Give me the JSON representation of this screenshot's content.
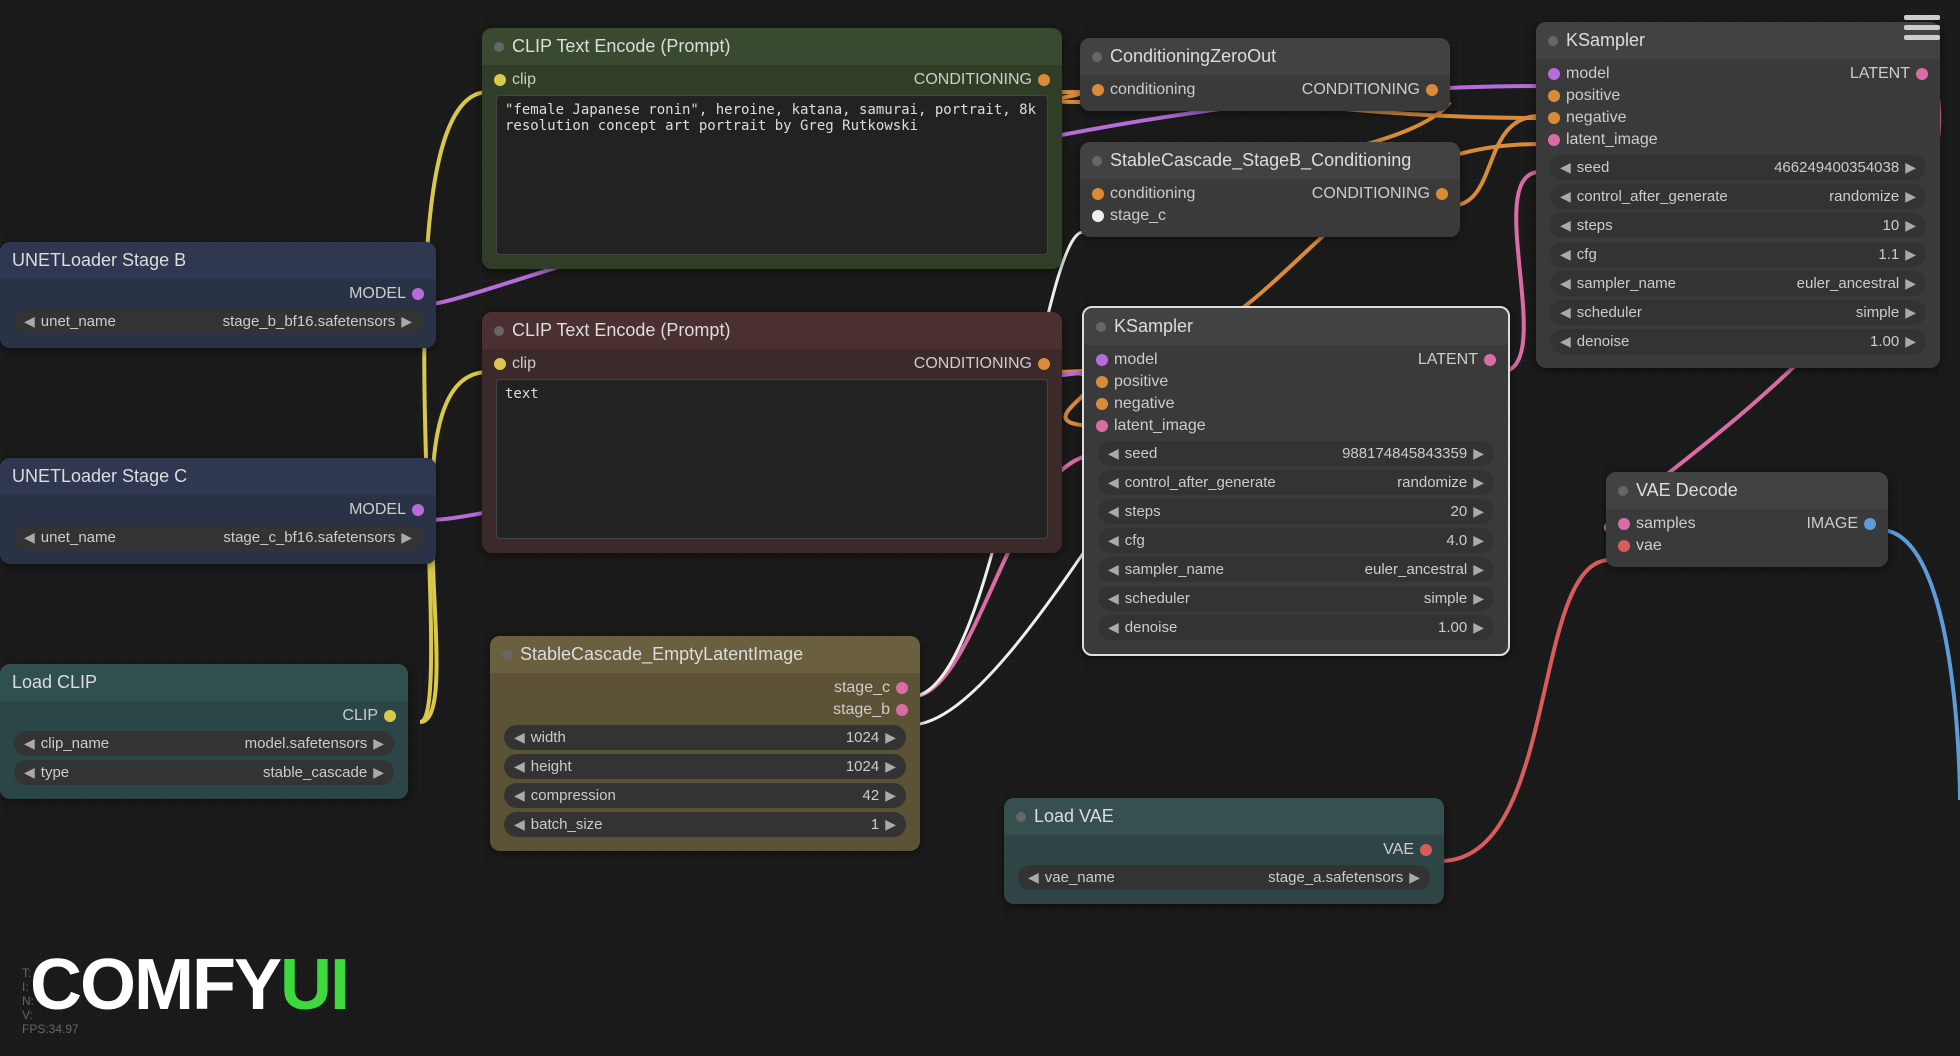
{
  "logo": {
    "part1": "COMFY",
    "part2": "UI"
  },
  "stats": {
    "t": "T: ",
    "i": "I: ",
    "n": "N: ",
    "v": "V: ",
    "fps": "FPS:34.97"
  },
  "nodes": {
    "unet_b": {
      "title": "UNETLoader Stage B",
      "out": "MODEL",
      "widget": {
        "label": "unet_name",
        "value": "stage_b_bf16.safetensors"
      }
    },
    "unet_c": {
      "title": "UNETLoader Stage C",
      "out": "MODEL",
      "widget": {
        "label": "unet_name",
        "value": "stage_c_bf16.safetensors"
      }
    },
    "load_clip": {
      "title": "Load CLIP",
      "out": "CLIP",
      "widgets": [
        {
          "label": "clip_name",
          "value": "model.safetensors"
        },
        {
          "label": "type",
          "value": "stable_cascade"
        }
      ]
    },
    "clip_pos": {
      "title": "CLIP Text Encode (Prompt)",
      "in": "clip",
      "out": "CONDITIONING",
      "text": "\"female Japanese ronin\", heroine, katana, samurai, portrait, 8k\nresolution concept art portrait by Greg Rutkowski"
    },
    "clip_neg": {
      "title": "CLIP Text Encode (Prompt)",
      "in": "clip",
      "out": "CONDITIONING",
      "text": "text"
    },
    "empty_latent": {
      "title": "StableCascade_EmptyLatentImage",
      "out1": "stage_c",
      "out2": "stage_b",
      "widgets": [
        {
          "label": "width",
          "value": "1024"
        },
        {
          "label": "height",
          "value": "1024"
        },
        {
          "label": "compression",
          "value": "42"
        },
        {
          "label": "batch_size",
          "value": "1"
        }
      ]
    },
    "cond_zero": {
      "title": "ConditioningZeroOut",
      "in": "conditioning",
      "out": "CONDITIONING"
    },
    "stageb_cond": {
      "title": "StableCascade_StageB_Conditioning",
      "in1": "conditioning",
      "in2": "stage_c",
      "out": "CONDITIONING"
    },
    "ksampler1": {
      "title": "KSampler",
      "ins": [
        "model",
        "positive",
        "negative",
        "latent_image"
      ],
      "out": "LATENT",
      "widgets": [
        {
          "label": "seed",
          "value": "988174845843359"
        },
        {
          "label": "control_after_generate",
          "value": "randomize"
        },
        {
          "label": "steps",
          "value": "20"
        },
        {
          "label": "cfg",
          "value": "4.0"
        },
        {
          "label": "sampler_name",
          "value": "euler_ancestral"
        },
        {
          "label": "scheduler",
          "value": "simple"
        },
        {
          "label": "denoise",
          "value": "1.00"
        }
      ]
    },
    "ksampler2": {
      "title": "KSampler",
      "ins": [
        "model",
        "positive",
        "negative",
        "latent_image"
      ],
      "out": "LATENT",
      "widgets": [
        {
          "label": "seed",
          "value": "466249400354038"
        },
        {
          "label": "control_after_generate",
          "value": "randomize"
        },
        {
          "label": "steps",
          "value": "10"
        },
        {
          "label": "cfg",
          "value": "1.1"
        },
        {
          "label": "sampler_name",
          "value": "euler_ancestral"
        },
        {
          "label": "scheduler",
          "value": "simple"
        },
        {
          "label": "denoise",
          "value": "1.00"
        }
      ]
    },
    "load_vae": {
      "title": "Load VAE",
      "out": "VAE",
      "widget": {
        "label": "vae_name",
        "value": "stage_a.safetensors"
      }
    },
    "vae_decode": {
      "title": "VAE Decode",
      "in1": "samples",
      "in2": "vae",
      "out": "IMAGE"
    }
  }
}
